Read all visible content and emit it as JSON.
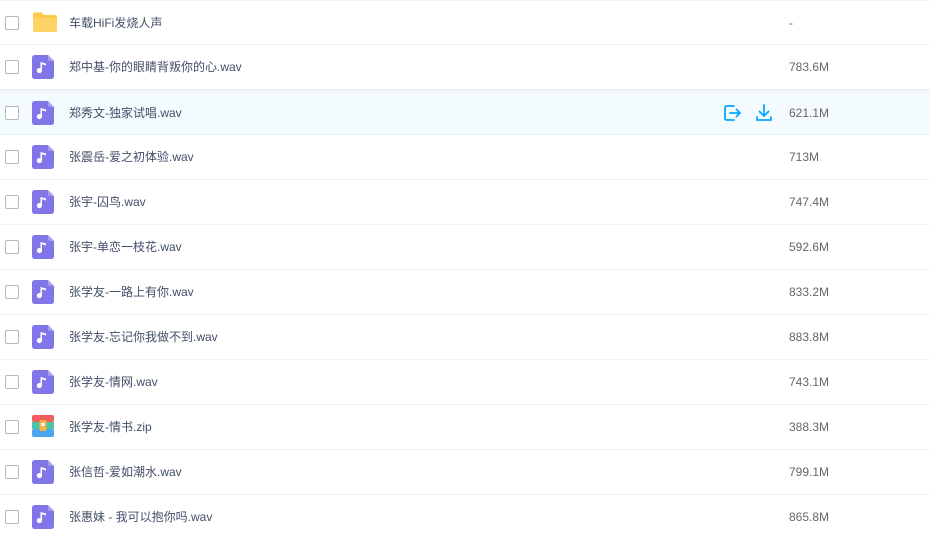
{
  "colors": {
    "folder": "#ffc94a",
    "audio_file": "#8176e8",
    "accent": "#06a7ff",
    "hover_row": "#f4fbff",
    "zip_top": "#f25d5d",
    "zip_mid": "#4bc4a5",
    "zip_bottom": "#4aa6ef",
    "zip_clasp": "#f7b548"
  },
  "row_actions": {
    "share_icon": "share-icon",
    "download_icon": "download-icon"
  },
  "files": [
    {
      "name": "车载HiFi发烧人声",
      "size": "-",
      "type": "folder"
    },
    {
      "name": "郑中基-你的眼睛背叛你的心.wav",
      "size": "783.6M",
      "type": "audio"
    },
    {
      "name": "郑秀文-独家试唱.wav",
      "size": "621.1M",
      "type": "audio"
    },
    {
      "name": "张震岳-爱之初体验.wav",
      "size": "713M",
      "type": "audio"
    },
    {
      "name": "张宇-囚鸟.wav",
      "size": "747.4M",
      "type": "audio"
    },
    {
      "name": "张宇-单恋一枝花.wav",
      "size": "592.6M",
      "type": "audio"
    },
    {
      "name": "张学友-一路上有你.wav",
      "size": "833.2M",
      "type": "audio"
    },
    {
      "name": "张学友-忘记你我做不到.wav",
      "size": "883.8M",
      "type": "audio"
    },
    {
      "name": "张学友-情网.wav",
      "size": "743.1M",
      "type": "audio"
    },
    {
      "name": "张学友-情书.zip",
      "size": "388.3M",
      "type": "zip"
    },
    {
      "name": "张信哲-爱如潮水.wav",
      "size": "799.1M",
      "type": "audio"
    },
    {
      "name": "张惠妹 - 我可以抱你吗.wav",
      "size": "865.8M",
      "type": "audio"
    }
  ]
}
